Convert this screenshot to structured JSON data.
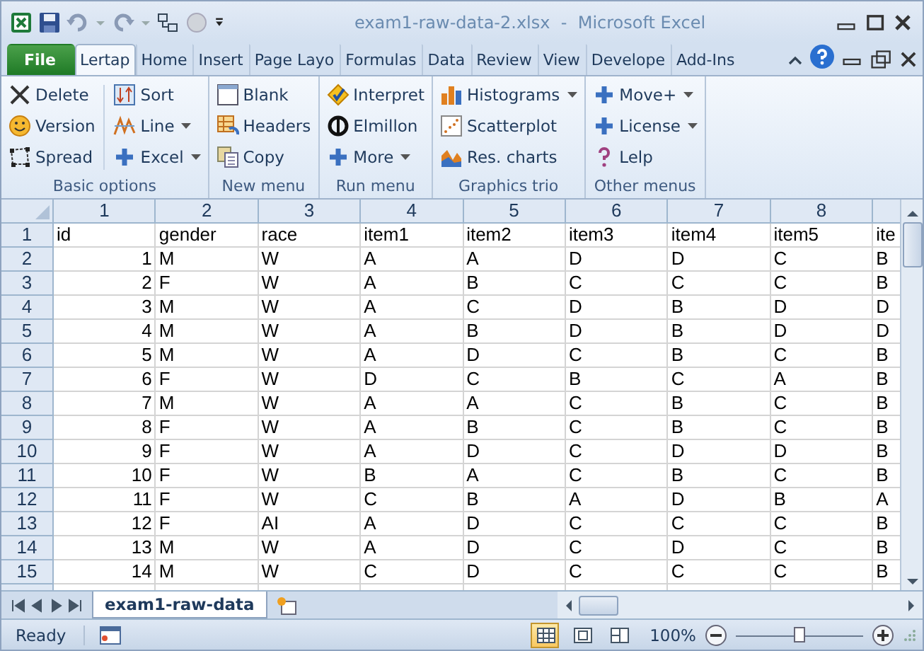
{
  "window": {
    "title": "exam1-raw-data-2.xlsx  -  Microsoft Excel"
  },
  "tabs": [
    {
      "label": "File",
      "kind": "file",
      "selected": false
    },
    {
      "label": "Lertap",
      "kind": "tab",
      "selected": true
    },
    {
      "label": "Home",
      "kind": "tab",
      "selected": false
    },
    {
      "label": "Insert",
      "kind": "tab",
      "selected": false
    },
    {
      "label": "Page Layo",
      "kind": "tab",
      "selected": false
    },
    {
      "label": "Formulas",
      "kind": "tab",
      "selected": false
    },
    {
      "label": "Data",
      "kind": "tab",
      "selected": false
    },
    {
      "label": "Review",
      "kind": "tab",
      "selected": false
    },
    {
      "label": "View",
      "kind": "tab",
      "selected": false
    },
    {
      "label": "Develope",
      "kind": "tab",
      "selected": false
    },
    {
      "label": "Add-Ins",
      "kind": "tab",
      "selected": false
    }
  ],
  "ribbon": {
    "groups": [
      {
        "label": "Basic options",
        "columns": [
          [
            {
              "label": "Delete",
              "dropdown": false
            },
            {
              "label": "Version",
              "dropdown": false
            },
            {
              "label": "Spread",
              "dropdown": false
            }
          ],
          [
            {
              "label": "Sort",
              "dropdown": false
            },
            {
              "label": "Line",
              "dropdown": true
            },
            {
              "label": "Excel",
              "dropdown": true
            }
          ]
        ]
      },
      {
        "label": "New menu",
        "columns": [
          [
            {
              "label": "Blank",
              "dropdown": false
            },
            {
              "label": "Headers",
              "dropdown": false
            },
            {
              "label": "Copy",
              "dropdown": false
            }
          ]
        ]
      },
      {
        "label": "Run menu",
        "columns": [
          [
            {
              "label": "Interpret",
              "dropdown": false
            },
            {
              "label": "Elmillon",
              "dropdown": false
            },
            {
              "label": "More",
              "dropdown": true
            }
          ]
        ]
      },
      {
        "label": "Graphics trio",
        "columns": [
          [
            {
              "label": "Histograms",
              "dropdown": true
            },
            {
              "label": "Scatterplot",
              "dropdown": false
            },
            {
              "label": "Res. charts",
              "dropdown": false
            }
          ]
        ]
      },
      {
        "label": "Other menus",
        "columns": [
          [
            {
              "label": "Move+",
              "dropdown": true
            },
            {
              "label": "License",
              "dropdown": true
            },
            {
              "label": "Lelp",
              "dropdown": false
            }
          ]
        ]
      }
    ]
  },
  "sheet": {
    "column_headers": [
      "1",
      "2",
      "3",
      "4",
      "5",
      "6",
      "7",
      "8"
    ],
    "rows": [
      {
        "number": "1",
        "cells": [
          "id",
          "gender",
          "race",
          "item1",
          "item2",
          "item3",
          "item4",
          "item5",
          "ite"
        ]
      },
      {
        "number": "2",
        "cells": [
          "1",
          "M",
          "W",
          "A",
          "A",
          "D",
          "D",
          "C",
          "B"
        ]
      },
      {
        "number": "3",
        "cells": [
          "2",
          "F",
          "W",
          "A",
          "B",
          "C",
          "C",
          "C",
          "B"
        ]
      },
      {
        "number": "4",
        "cells": [
          "3",
          "M",
          "W",
          "A",
          "C",
          "D",
          "B",
          "D",
          "D"
        ]
      },
      {
        "number": "5",
        "cells": [
          "4",
          "M",
          "W",
          "A",
          "B",
          "D",
          "B",
          "D",
          "D"
        ]
      },
      {
        "number": "6",
        "cells": [
          "5",
          "M",
          "W",
          "A",
          "D",
          "C",
          "B",
          "C",
          "B"
        ]
      },
      {
        "number": "7",
        "cells": [
          "6",
          "F",
          "W",
          "D",
          "C",
          "B",
          "C",
          "A",
          "B"
        ]
      },
      {
        "number": "8",
        "cells": [
          "7",
          "M",
          "W",
          "A",
          "A",
          "C",
          "B",
          "C",
          "B"
        ]
      },
      {
        "number": "9",
        "cells": [
          "8",
          "F",
          "W",
          "A",
          "B",
          "C",
          "B",
          "C",
          "B"
        ]
      },
      {
        "number": "10",
        "cells": [
          "9",
          "F",
          "W",
          "A",
          "D",
          "C",
          "D",
          "D",
          "B"
        ]
      },
      {
        "number": "11",
        "cells": [
          "10",
          "F",
          "W",
          "B",
          "A",
          "C",
          "B",
          "C",
          "B"
        ]
      },
      {
        "number": "12",
        "cells": [
          "11",
          "F",
          "W",
          "C",
          "B",
          "A",
          "D",
          "B",
          "A"
        ]
      },
      {
        "number": "13",
        "cells": [
          "12",
          "F",
          "AI",
          "A",
          "D",
          "C",
          "C",
          "C",
          "B"
        ]
      },
      {
        "number": "14",
        "cells": [
          "13",
          "M",
          "W",
          "A",
          "D",
          "C",
          "D",
          "C",
          "B"
        ]
      },
      {
        "number": "15",
        "cells": [
          "14",
          "M",
          "W",
          "C",
          "D",
          "C",
          "C",
          "C",
          "B"
        ]
      }
    ]
  },
  "sheet_tabs": [
    {
      "label": "exam1-raw-data",
      "selected": true
    }
  ],
  "status_bar": {
    "status": "Ready",
    "views": [
      {
        "selected": true
      },
      {
        "selected": false
      },
      {
        "selected": false
      }
    ],
    "zoom_label": "100%",
    "zoom": {
      "level": 0.5
    }
  }
}
